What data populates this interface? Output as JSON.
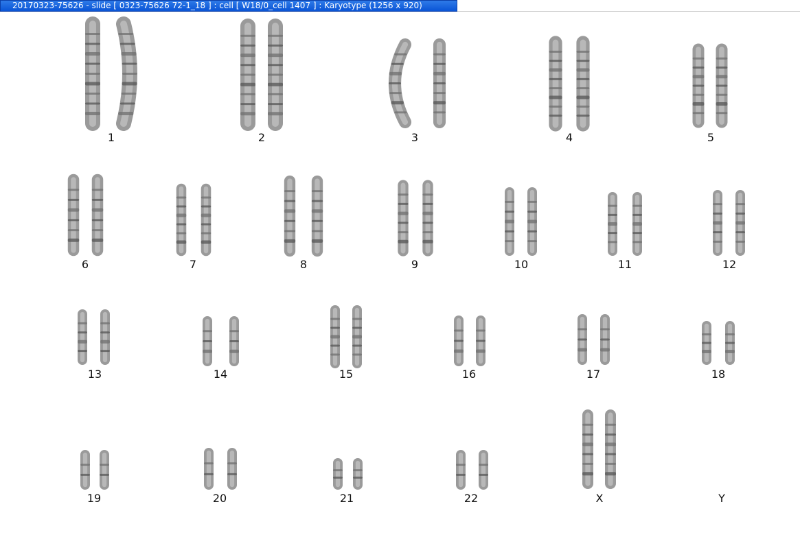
{
  "window": {
    "title": "20170323-75626 - slide [ 0323-75626 72-1_18 ] : cell [ W18/0_cell 1407 ] : Karyotype  (1256 x 920)"
  },
  "karyotype": {
    "chromosomes": [
      {
        "label": "1",
        "count": 2
      },
      {
        "label": "2",
        "count": 2
      },
      {
        "label": "3",
        "count": 2
      },
      {
        "label": "4",
        "count": 2
      },
      {
        "label": "5",
        "count": 2
      },
      {
        "label": "6",
        "count": 2
      },
      {
        "label": "7",
        "count": 2
      },
      {
        "label": "8",
        "count": 2
      },
      {
        "label": "9",
        "count": 2
      },
      {
        "label": "10",
        "count": 2
      },
      {
        "label": "11",
        "count": 2
      },
      {
        "label": "12",
        "count": 2
      },
      {
        "label": "13",
        "count": 2
      },
      {
        "label": "14",
        "count": 2
      },
      {
        "label": "15",
        "count": 2
      },
      {
        "label": "16",
        "count": 2
      },
      {
        "label": "17",
        "count": 2
      },
      {
        "label": "18",
        "count": 2
      },
      {
        "label": "19",
        "count": 2
      },
      {
        "label": "20",
        "count": 2
      },
      {
        "label": "21",
        "count": 2
      },
      {
        "label": "22",
        "count": 2
      },
      {
        "label": "X",
        "count": 2
      },
      {
        "label": "Y",
        "count": 0
      }
    ]
  }
}
